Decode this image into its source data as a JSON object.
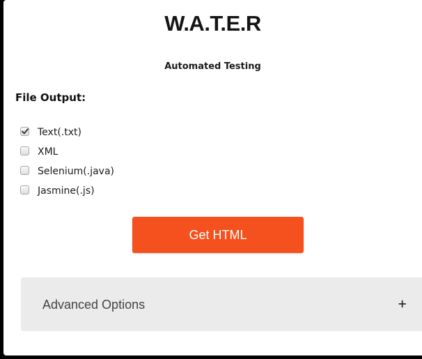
{
  "header": {
    "title": "W.A.T.E.R",
    "subtitle": "Automated Testing"
  },
  "file_output": {
    "heading": "File Output:",
    "options": [
      {
        "label": "Text(.txt)",
        "checked": true
      },
      {
        "label": "XML",
        "checked": false
      },
      {
        "label": "Selenium(.java)",
        "checked": false
      },
      {
        "label": "Jasmine(.js)",
        "checked": false
      }
    ]
  },
  "actions": {
    "get_html_label": "Get HTML"
  },
  "advanced": {
    "label": "Advanced Options",
    "toggle_symbol": "+"
  },
  "colors": {
    "accent": "#f4511e",
    "panel_bg": "#ebebeb",
    "page_bg": "#ffffff",
    "frame_bg": "#000000"
  },
  "icons": {
    "checkmark": "check-icon",
    "expand": "plus-icon"
  }
}
